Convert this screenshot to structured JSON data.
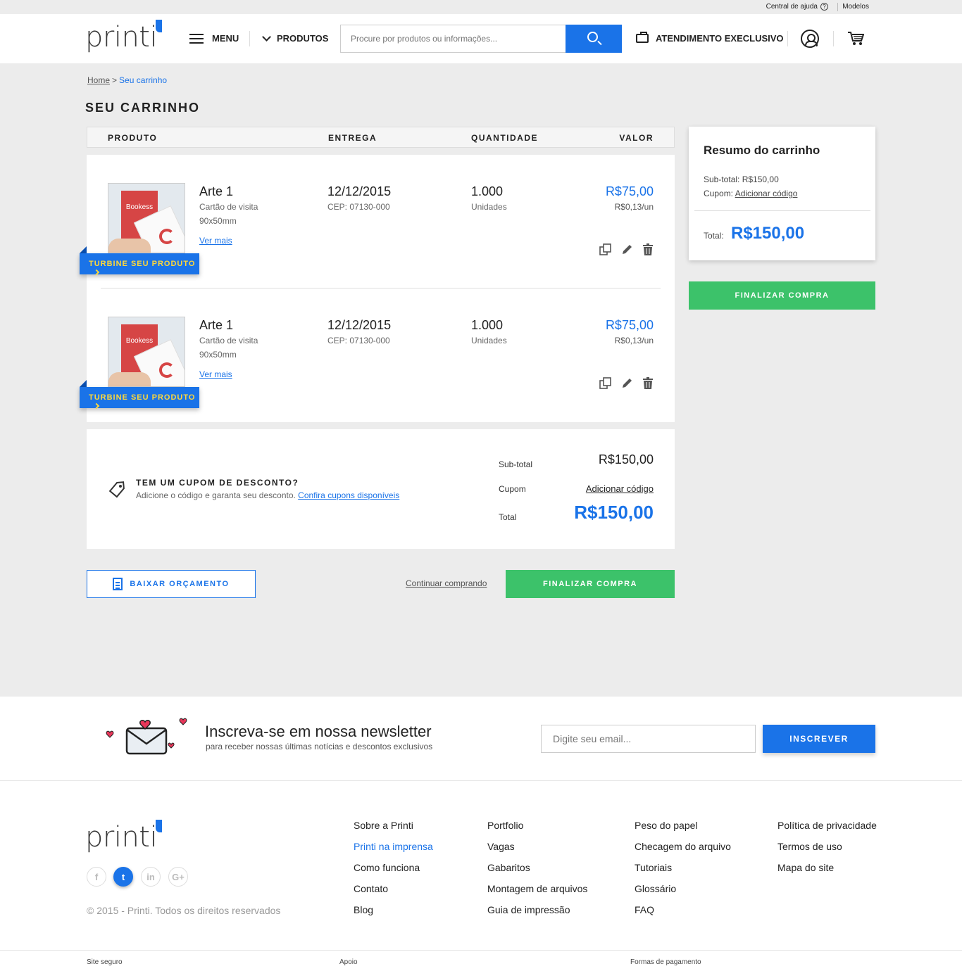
{
  "topbar": {
    "help_label": "Central de ajuda",
    "help_icon": "?",
    "models_label": "Modelos"
  },
  "header": {
    "logo_text": "printi",
    "menu_label": "MENU",
    "products_label": "PRODUTOS",
    "search_placeholder": "Procure por produtos ou informações...",
    "service_label": "ATENDIMENTO EXECLUSIVO"
  },
  "breadcrumb": {
    "home": "Home",
    "separator": ">",
    "current": "Seu carrinho"
  },
  "page_title": "SEU CARRINHO",
  "table_header": {
    "product": "PRODUTO",
    "delivery": "ENTREGA",
    "quantity": "QUANTIDADE",
    "value": "VALOR"
  },
  "items": [
    {
      "thumb_text": "Bookess",
      "name": "Arte 1",
      "type": "Cartão de visita",
      "size": "90x50mm",
      "more": "Ver mais",
      "date": "12/12/2015",
      "cep": "CEP: 07130-000",
      "qty": "1.000",
      "unit": "Unidades",
      "price": "R$75,00",
      "unit_price": "R$0,13/un",
      "turbine": "TURBINE SEU PRODUTO"
    },
    {
      "thumb_text": "Bookess",
      "name": "Arte 1",
      "type": "Cartão de visita",
      "size": "90x50mm",
      "more": "Ver mais",
      "date": "12/12/2015",
      "cep": "CEP: 07130-000",
      "qty": "1.000",
      "unit": "Unidades",
      "price": "R$75,00",
      "unit_price": "R$0,13/un",
      "turbine": "TURBINE SEU PRODUTO"
    }
  ],
  "coupon": {
    "title": "TEM UM CUPOM DE DESCONTO?",
    "desc": "Adicione o código e garanta seu desconto.",
    "link": "Confira cupons disponíveis",
    "subtotal_label": "Sub-total",
    "subtotal_value": "R$150,00",
    "coupon_label": "Cupom",
    "coupon_value": "Adicionar código",
    "total_label": "Total",
    "total_value": "R$150,00"
  },
  "actions": {
    "download": "BAIXAR ORÇAMENTO",
    "continue": "Continuar comprando",
    "checkout": "FINALIZAR COMPRA"
  },
  "summary": {
    "title": "Resumo do carrinho",
    "subtotal": "Sub-total: R$150,00",
    "coupon_label": "Cupom:",
    "coupon_link": "Adicionar código",
    "total_label": "Total:",
    "total_value": "R$150,00",
    "checkout": "FINALIZAR COMPRA"
  },
  "newsletter": {
    "title": "Inscreva-se em nossa newsletter",
    "subtitle": "para receber nossas últimas notícias e descontos exclusivos",
    "placeholder": "Digite seu email...",
    "button": "INSCREVER"
  },
  "footer": {
    "logo_text": "printi",
    "social": [
      "f",
      "t",
      "in",
      "G+"
    ],
    "copyright": "© 2015 - Printi. Todos os direitos reservados",
    "col1": [
      "Sobre a Printi",
      "Printi na imprensa",
      "Como funciona",
      "Contato",
      "Blog"
    ],
    "col2": [
      "Portfolio",
      "Vagas",
      "Gabaritos",
      "Montagem de arquivos",
      "Guia de impressão"
    ],
    "col3": [
      "Peso do papel",
      "Checagem do arquivo",
      "Tutoriais",
      "Glossário",
      "FAQ"
    ],
    "col4": [
      "Política de privacidade",
      "Termos de uso",
      "Mapa do site"
    ],
    "bottom": [
      "Site seguro",
      "Apoio",
      "Formas de pagamento"
    ]
  },
  "colors": {
    "accent": "#1a73e8",
    "success": "#3cc26a",
    "highlight": "#ffd83a"
  }
}
